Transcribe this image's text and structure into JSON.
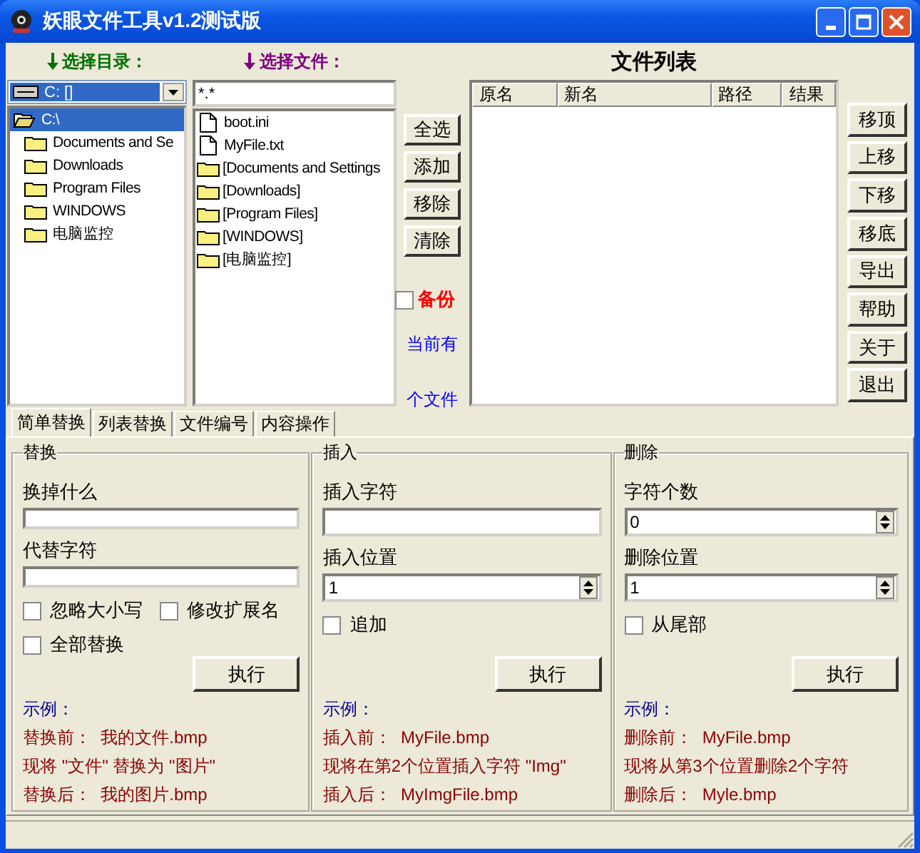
{
  "window": {
    "title": "妖眼文件工具v1.2测试版"
  },
  "dir_picker": {
    "label": "选择目录：",
    "drive": "C: []",
    "tree": [
      {
        "label": "C:\\",
        "selected": true,
        "children": [
          {
            "label": "Documents and Se",
            "selected": false
          },
          {
            "label": "Downloads",
            "selected": false
          },
          {
            "label": "Program Files",
            "selected": false
          },
          {
            "label": "WINDOWS",
            "selected": false
          },
          {
            "label": "电脑监控",
            "selected": false
          }
        ]
      }
    ]
  },
  "file_picker": {
    "label": "选择文件：",
    "filter": "*.*",
    "files": [
      {
        "name": "boot.ini",
        "kind": "file"
      },
      {
        "name": "MyFile.txt",
        "kind": "file"
      },
      {
        "name": "[Documents and Settings",
        "kind": "folder"
      },
      {
        "name": "[Downloads]",
        "kind": "folder"
      },
      {
        "name": "[Program Files]",
        "kind": "folder"
      },
      {
        "name": "[WINDOWS]",
        "kind": "folder"
      },
      {
        "name": "[电脑监控]",
        "kind": "folder"
      }
    ]
  },
  "list_buttons": [
    "全选",
    "添加",
    "移除",
    "清除"
  ],
  "backup": {
    "label": "备份",
    "checked": false
  },
  "count": {
    "before": "当前有",
    "after": "个文件"
  },
  "file_list": {
    "title": "文件列表",
    "columns": [
      "原名",
      "新名",
      "路径",
      "结果"
    ]
  },
  "side_buttons": [
    "移顶",
    "上移",
    "下移",
    "移底",
    "导出",
    "帮助",
    "关于",
    "退出"
  ],
  "tabs": [
    {
      "label": "简单替换",
      "selected": true
    },
    {
      "label": "列表替换",
      "selected": false
    },
    {
      "label": "文件编号",
      "selected": false
    },
    {
      "label": "内容操作",
      "selected": false
    }
  ],
  "groups": [
    {
      "title": "替换",
      "fields": [
        {
          "label": "换掉什么",
          "kind": "text"
        },
        {
          "label": "代替字符",
          "kind": "text"
        }
      ],
      "checkbox_rows": [
        [
          {
            "label": "忽略大小写",
            "checked": false
          },
          {
            "label": "修改扩展名",
            "checked": false
          }
        ],
        [
          {
            "label": "全部替换",
            "checked": false
          }
        ]
      ],
      "button": "执行",
      "example_title": "示例：",
      "example_lines": [
        "替换前：  我的文件.bmp",
        "现将 \"文件\" 替换为 \"图片\"",
        "替换后：  我的图片.bmp"
      ]
    },
    {
      "title": "插入",
      "fields": [
        {
          "label": "插入字符",
          "kind": "text"
        },
        {
          "label": "插入位置",
          "kind": "spin",
          "value": "1"
        }
      ],
      "checkbox_rows": [
        [
          {
            "label": "追加",
            "checked": false
          }
        ]
      ],
      "button": "执行",
      "example_title": "示例：",
      "example_lines": [
        "插入前：  MyFile.bmp",
        "现将在第2个位置插入字符 \"Img\"",
        "插入后：  MyImgFile.bmp"
      ]
    },
    {
      "title": "删除",
      "fields": [
        {
          "label": "字符个数",
          "kind": "spin",
          "value": "0"
        },
        {
          "label": "删除位置",
          "kind": "spin",
          "value": "1"
        }
      ],
      "checkbox_rows": [
        [
          {
            "label": "从尾部",
            "checked": false
          }
        ]
      ],
      "button": "执行",
      "example_title": "示例：",
      "example_lines": [
        "删除前：  MyFile.bmp",
        "现将从第3个位置删除2个字符",
        "删除后：  Myle.bmp"
      ]
    }
  ]
}
